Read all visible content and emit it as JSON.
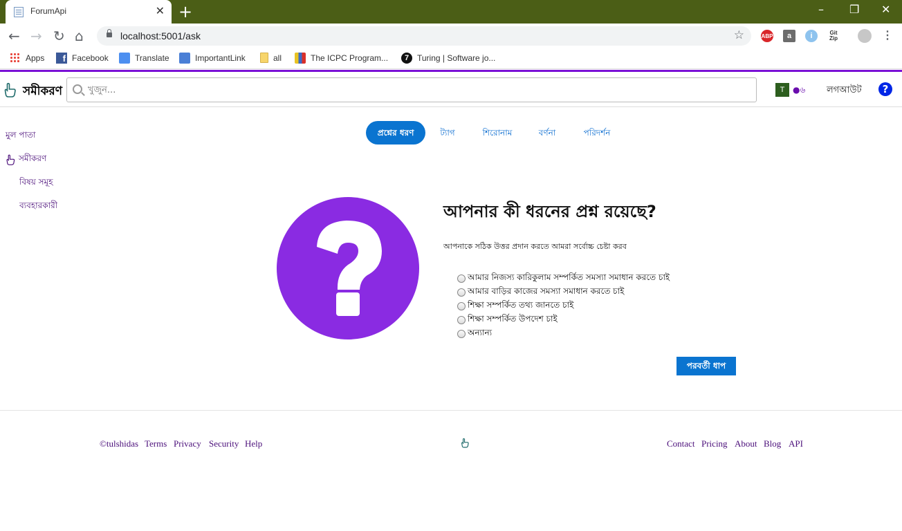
{
  "browser": {
    "tab_title": "ForumApi",
    "tab_close": "✕",
    "new_tab": "+",
    "url": "localhost:5001/ask",
    "win_min": "–",
    "win_max": "❐",
    "win_close": "✕",
    "extensions": {
      "abp": "ABP",
      "a": "a",
      "i": "i",
      "git": "Git\nZip"
    },
    "bookmarks": [
      {
        "label": "Apps",
        "icon": "apps-grid-icon"
      },
      {
        "label": "Facebook",
        "icon": "facebook-icon"
      },
      {
        "label": "Translate",
        "icon": "google-translate-icon"
      },
      {
        "label": "ImportantLink",
        "icon": "document-icon"
      },
      {
        "label": "all",
        "icon": "folder-icon"
      },
      {
        "label": "The ICPC Program...",
        "icon": "icpc-icon"
      },
      {
        "label": "Turing | Software jo...",
        "icon": "turing-icon"
      }
    ]
  },
  "header": {
    "logo_text": "সমীকরণ",
    "search_placeholder": "খুজুন...",
    "avatar_letter": "T",
    "reputation": "●৬",
    "logout": "লগআউট",
    "help": "?"
  },
  "sidebar": {
    "items": [
      {
        "label": "মুল পাতা"
      },
      {
        "label": "সমীকরণ"
      },
      {
        "label": "বিষয় সমূহ"
      },
      {
        "label": "ব্যবহারকারী"
      }
    ]
  },
  "steps": [
    {
      "label": "প্রশ্নের ধরণ",
      "active": true
    },
    {
      "label": "ট্যাগ"
    },
    {
      "label": "শিরোনাম"
    },
    {
      "label": "বর্ণনা"
    },
    {
      "label": "পরিদর্শন"
    }
  ],
  "main": {
    "heading": "আপনার কী ধরনের প্রশ্ন রয়েছে?",
    "subtitle": "আপনাকে সঠিক উত্তর প্রদান করতে আমরা সর্বোচ্চ চেষ্টা করব",
    "options": [
      "আমার নিজস্য কারিকুলাম সম্পর্কিত সমস্যা সমাধান করতে চাই",
      "আমার বাড়ির কাজের সমস্যা সমাধান করতে চাই",
      "শিক্ষা সম্পর্কিত তথ্য জানতে চাই",
      "শিক্ষা সম্পর্কিত উপদেশ চাই",
      "অন্যান্য"
    ],
    "next_button": "পরবর্তী ধাপ",
    "illustration_color": "#8a2be2"
  },
  "footer": {
    "left": [
      "©tulshidas",
      "Terms",
      "Privacy",
      "Security",
      "Help"
    ],
    "right": [
      "Contact",
      "Pricing",
      "About",
      "Blog",
      "API"
    ]
  },
  "colors": {
    "titlebar": "#4b5e16",
    "accent_bar": "#7a10d6",
    "primary": "#0a74d0",
    "link": "#4b0f7a"
  }
}
